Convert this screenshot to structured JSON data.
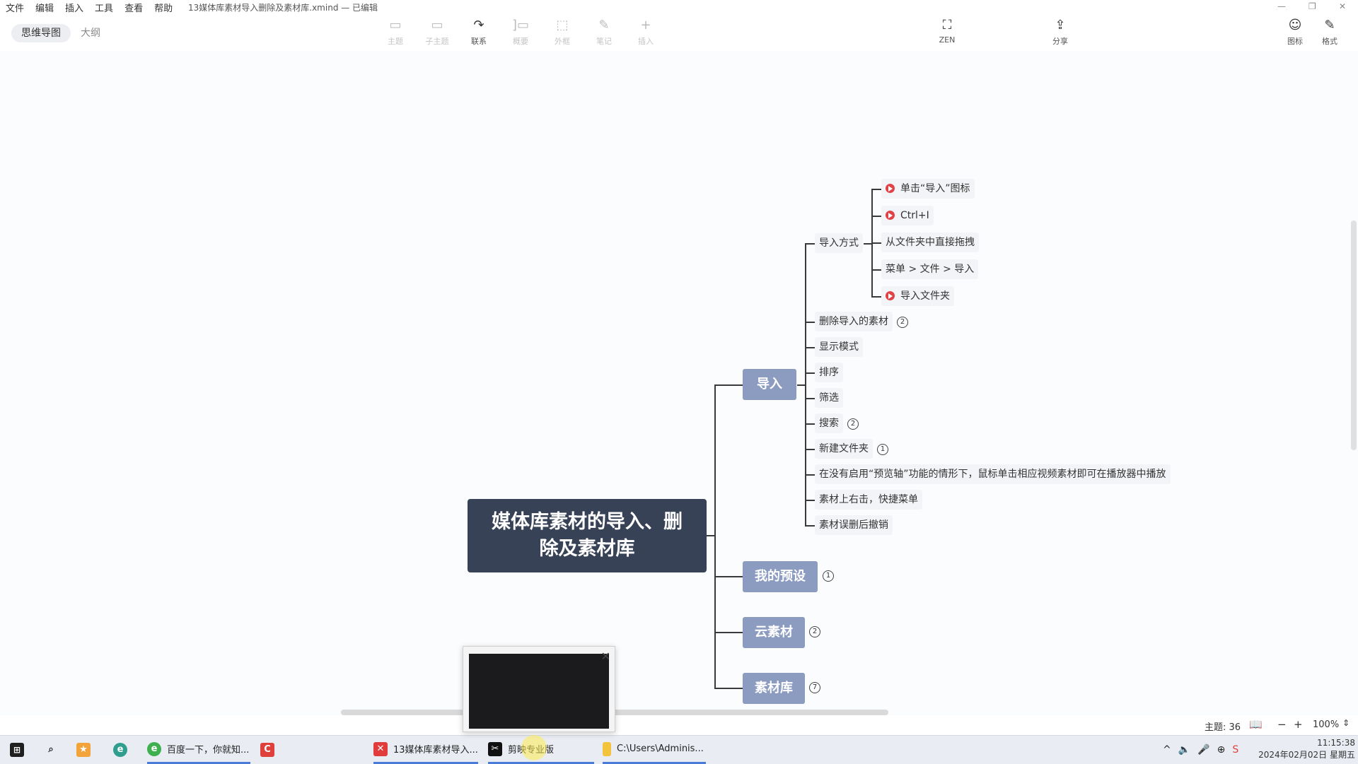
{
  "menu": [
    "文件",
    "编辑",
    "插入",
    "工具",
    "查看",
    "帮助"
  ],
  "doc_title": "13媒体库素材导入删除及素材库.xmind — 已编辑",
  "window_controls": [
    "—",
    "❐",
    "✕"
  ],
  "view_tabs": [
    "思维导图",
    "大纲"
  ],
  "toolbar": {
    "topic": {
      "icon": "▭",
      "label": "主题"
    },
    "subtopic": {
      "icon": "▭",
      "label": "子主题"
    },
    "relation": {
      "icon": "↷",
      "label": "联系"
    },
    "summary": {
      "icon": "]▭",
      "label": "概要"
    },
    "boundary": {
      "icon": "⬚",
      "label": "外框"
    },
    "note": {
      "icon": "✎",
      "label": "笔记"
    },
    "insert": {
      "icon": "+",
      "label": "插入"
    },
    "zen": {
      "icon": "⛶",
      "label": "ZEN"
    },
    "share": {
      "icon": "⇪",
      "label": "分享"
    },
    "icon_panel": {
      "icon": "☺",
      "label": "图标"
    },
    "format_panel": {
      "icon": "✎",
      "label": "格式"
    }
  },
  "mindmap": {
    "central": "媒体库素材的导入、删除及素材库",
    "main_topics": [
      {
        "label": "导入"
      },
      {
        "label": "我的预设",
        "badge": "1"
      },
      {
        "label": "云素材",
        "badge": "2"
      },
      {
        "label": "素材库",
        "badge": "7"
      }
    ],
    "import_children": [
      {
        "label": "导入方式"
      },
      {
        "label": "删除导入的素材",
        "badge": "2"
      },
      {
        "label": "显示模式"
      },
      {
        "label": "排序"
      },
      {
        "label": "筛选"
      },
      {
        "label": "搜索",
        "badge": "2"
      },
      {
        "label": "新建文件夹",
        "badge": "1"
      },
      {
        "label": "在没有启用“预览轴”功能的情形下，鼠标单击相应视频素材即可在播放器中播放"
      },
      {
        "label": "素材上右击，快捷菜单"
      },
      {
        "label": "素材误删后撤销"
      }
    ],
    "import_methods": [
      {
        "label": "单击“导入”图标",
        "marker": true
      },
      {
        "label": "Ctrl+I",
        "marker": true
      },
      {
        "label": "从文件夹中直接拖拽",
        "marker": false
      },
      {
        "label": "菜单 > 文件 > 导入",
        "marker": false
      },
      {
        "label": "导入文件夹",
        "marker": true
      }
    ]
  },
  "statusbar": {
    "topics": "主题: 36",
    "zoom": "100%",
    "minus": "−",
    "plus": "+"
  },
  "taskbar": {
    "items": [
      {
        "label": "百度一下，你就知..."
      },
      {
        "label": "13媒体库素材导入..."
      },
      {
        "label": "剪映专业版"
      },
      {
        "label": "C:\\Users\\Adminis..."
      }
    ],
    "time": "11:15:38",
    "date": "2024年02月02日 星期五"
  },
  "colors": {
    "central": "#374256",
    "main_topic": "#8c9bc0",
    "marker": "#e04245"
  }
}
